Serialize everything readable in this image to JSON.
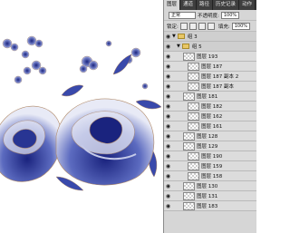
{
  "panel": {
    "tabs": [
      "图层",
      "通道",
      "路径",
      "历史记录",
      "动作"
    ],
    "blend_mode": "正常",
    "opacity_label": "不透明度:",
    "opacity_value": "100%",
    "lock_label": "锁定:",
    "fill_label": "填充:",
    "fill_value": "100%"
  },
  "layers": [
    {
      "name": "组 3",
      "group": true,
      "level": 0
    },
    {
      "name": "组 5",
      "group": true,
      "level": 1
    },
    {
      "name": "图层 193",
      "level": 2
    },
    {
      "name": "图层 187",
      "level": 3
    },
    {
      "name": "图层 187 副本 2",
      "level": 3
    },
    {
      "name": "图层 187 副本",
      "level": 3
    },
    {
      "name": "图层 181",
      "level": 2
    },
    {
      "name": "图层 182",
      "level": 3
    },
    {
      "name": "图层 162",
      "level": 3
    },
    {
      "name": "图层 161",
      "level": 3
    },
    {
      "name": "图层 128",
      "level": 2
    },
    {
      "name": "图层 129",
      "level": 2
    },
    {
      "name": "图层 190",
      "level": 3
    },
    {
      "name": "图层 159",
      "level": 3
    },
    {
      "name": "图层 158",
      "level": 3
    },
    {
      "name": "图层 130",
      "level": 2
    },
    {
      "name": "图层 131",
      "level": 2
    },
    {
      "name": "图层 183",
      "level": 2
    }
  ],
  "colors": {
    "porcelain_blue": "#2b3a9e",
    "panel_bg": "#d6d6d6"
  }
}
